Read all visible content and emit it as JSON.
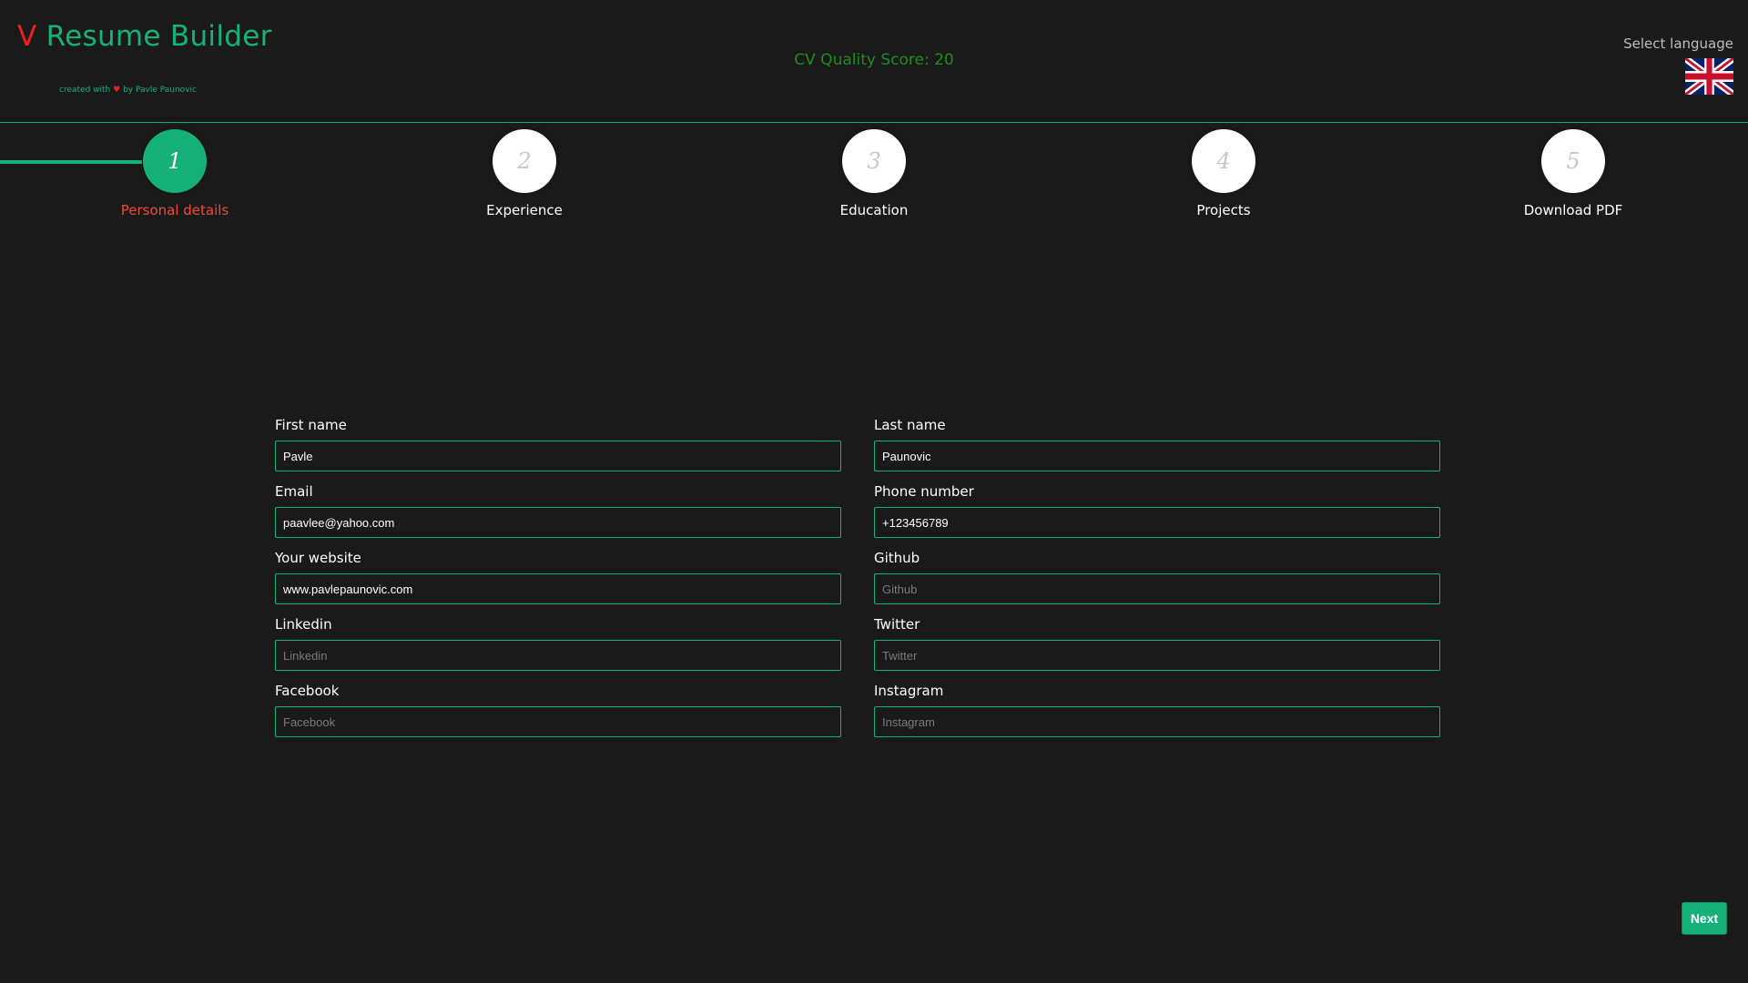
{
  "header": {
    "logo_letter": "V",
    "app_title": "Resume Builder",
    "credit_prefix": "created with",
    "credit_heart": "♥",
    "credit_suffix": "by Pavle Paunovic",
    "cv_quality_score": "CV Quality Score: 20",
    "language_label": "Select language",
    "language_flag": "uk-flag-icon"
  },
  "stepper": {
    "steps": [
      {
        "number": "1",
        "label": "Personal details",
        "active": true
      },
      {
        "number": "2",
        "label": "Experience",
        "active": false
      },
      {
        "number": "3",
        "label": "Education",
        "active": false
      },
      {
        "number": "4",
        "label": "Projects",
        "active": false
      },
      {
        "number": "5",
        "label": "Download PDF",
        "active": false
      }
    ]
  },
  "form": {
    "fields": [
      {
        "label": "First name",
        "value": "Pavle",
        "placeholder": "First name"
      },
      {
        "label": "Last name",
        "value": "Paunovic",
        "placeholder": "Last name"
      },
      {
        "label": "Email",
        "value": "paavlee@yahoo.com",
        "placeholder": "Email"
      },
      {
        "label": "Phone number",
        "value": "+123456789",
        "placeholder": "Phone number"
      },
      {
        "label": "Your website",
        "value": "www.pavlepaunovic.com",
        "placeholder": "Your website"
      },
      {
        "label": "Github",
        "value": "",
        "placeholder": "Github"
      },
      {
        "label": "Linkedin",
        "value": "",
        "placeholder": "Linkedin"
      },
      {
        "label": "Twitter",
        "value": "",
        "placeholder": "Twitter"
      },
      {
        "label": "Facebook",
        "value": "",
        "placeholder": "Facebook"
      },
      {
        "label": "Instagram",
        "value": "",
        "placeholder": "Instagram"
      }
    ]
  },
  "actions": {
    "next_label": "Next"
  },
  "colors": {
    "background": "#1a1a1a",
    "accent": "#16b07a",
    "logo_red": "#ee2020",
    "active_step_label": "#ef4a3a",
    "score_green": "#1b8f1b"
  }
}
